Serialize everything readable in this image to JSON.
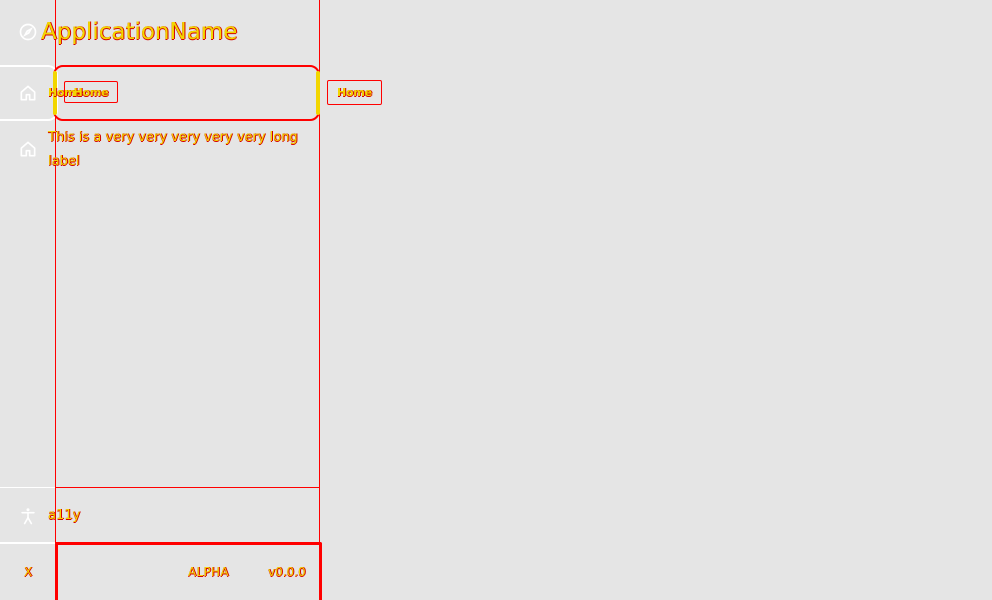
{
  "app": {
    "title": "ApplicationName"
  },
  "nav": {
    "items": [
      {
        "label": "Home",
        "icon": "home-icon",
        "chip": "Home"
      },
      {
        "label": "This is a very very very very very long label",
        "icon": "home-icon"
      }
    ],
    "detached_chip": "Home"
  },
  "footer": {
    "a11y_label": "a11y",
    "close_label": "X",
    "channel": "ALPHA",
    "version": "v0.0.0"
  },
  "icons": {
    "brand": "compass-icon",
    "nav": "home-icon",
    "accessibility": "accessibility-icon"
  },
  "colors": {
    "background": "#e5e5e5",
    "outline": "#ff0000",
    "text": "#f2d600",
    "active_rail": "#ffffff"
  }
}
